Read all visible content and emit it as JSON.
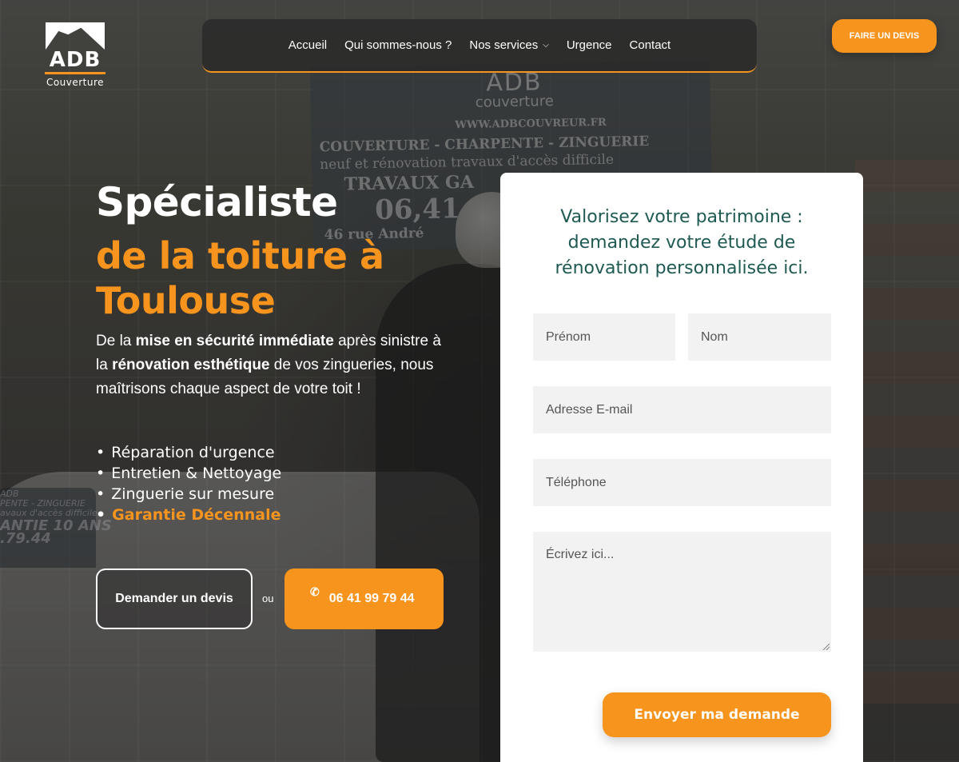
{
  "brand": {
    "name": "ADB",
    "tagline": "Couverture",
    "accent_color": "#f7941d",
    "title_color": "#1e5a52"
  },
  "background": {
    "banner_logo": "ADB",
    "banner_logo_sub": "couverture",
    "banner_url": "WWW.ADBCOUVREUR.FR",
    "banner_services": "COUVERTURE - CHARPENTE - ZINGUERIE",
    "banner_line3": "neuf et rénovation  travaux d'accès difficile",
    "banner_line4": "TRAVAUX GA",
    "banner_phone": "06,41",
    "banner_address": "46 rue André",
    "van_line1": "ADB",
    "van_line2": "PENTE - ZINGUERIE",
    "van_line3": "avaux d'accès difficile",
    "van_line4": "ANTIE 10 ANS",
    "van_line5": ".79.44"
  },
  "nav": {
    "items": [
      {
        "label": "Accueil"
      },
      {
        "label": "Qui sommes-nous ?"
      },
      {
        "label": "Nos services",
        "has_dropdown": true
      },
      {
        "label": "Urgence"
      },
      {
        "label": "Contact"
      }
    ],
    "cta_label": "FAIRE UN DEVIS"
  },
  "hero": {
    "title_line1": "Spécialiste",
    "title_line2": "de la toiture à Toulouse",
    "desc_part1": "De la ",
    "desc_bold1": "mise en sécurité immédiate",
    "desc_part2": " après sinistre à la ",
    "desc_bold2": "rénovation esthétique",
    "desc_part3": " de vos zingueries, nous maîtrisons chaque aspect de votre toit !",
    "features": [
      "Réparation d'urgence",
      "Entretien & Nettoyage",
      "Zinguerie sur mesure",
      "Garantie Décennale"
    ],
    "btn_devis": "Demander un devis",
    "or_label": "ou",
    "phone_icon": "phone-icon",
    "phone_number": "06 41 99 79 44"
  },
  "form": {
    "title": "Valorisez votre patrimoine : demandez votre étude de rénovation personnalisée ici.",
    "firstname_placeholder": "Prénom",
    "lastname_placeholder": "Nom",
    "email_placeholder": "Adresse E-mail",
    "phone_placeholder": "Téléphone",
    "message_placeholder": "Écrivez ici...",
    "submit_label": "Envoyer ma demande"
  }
}
